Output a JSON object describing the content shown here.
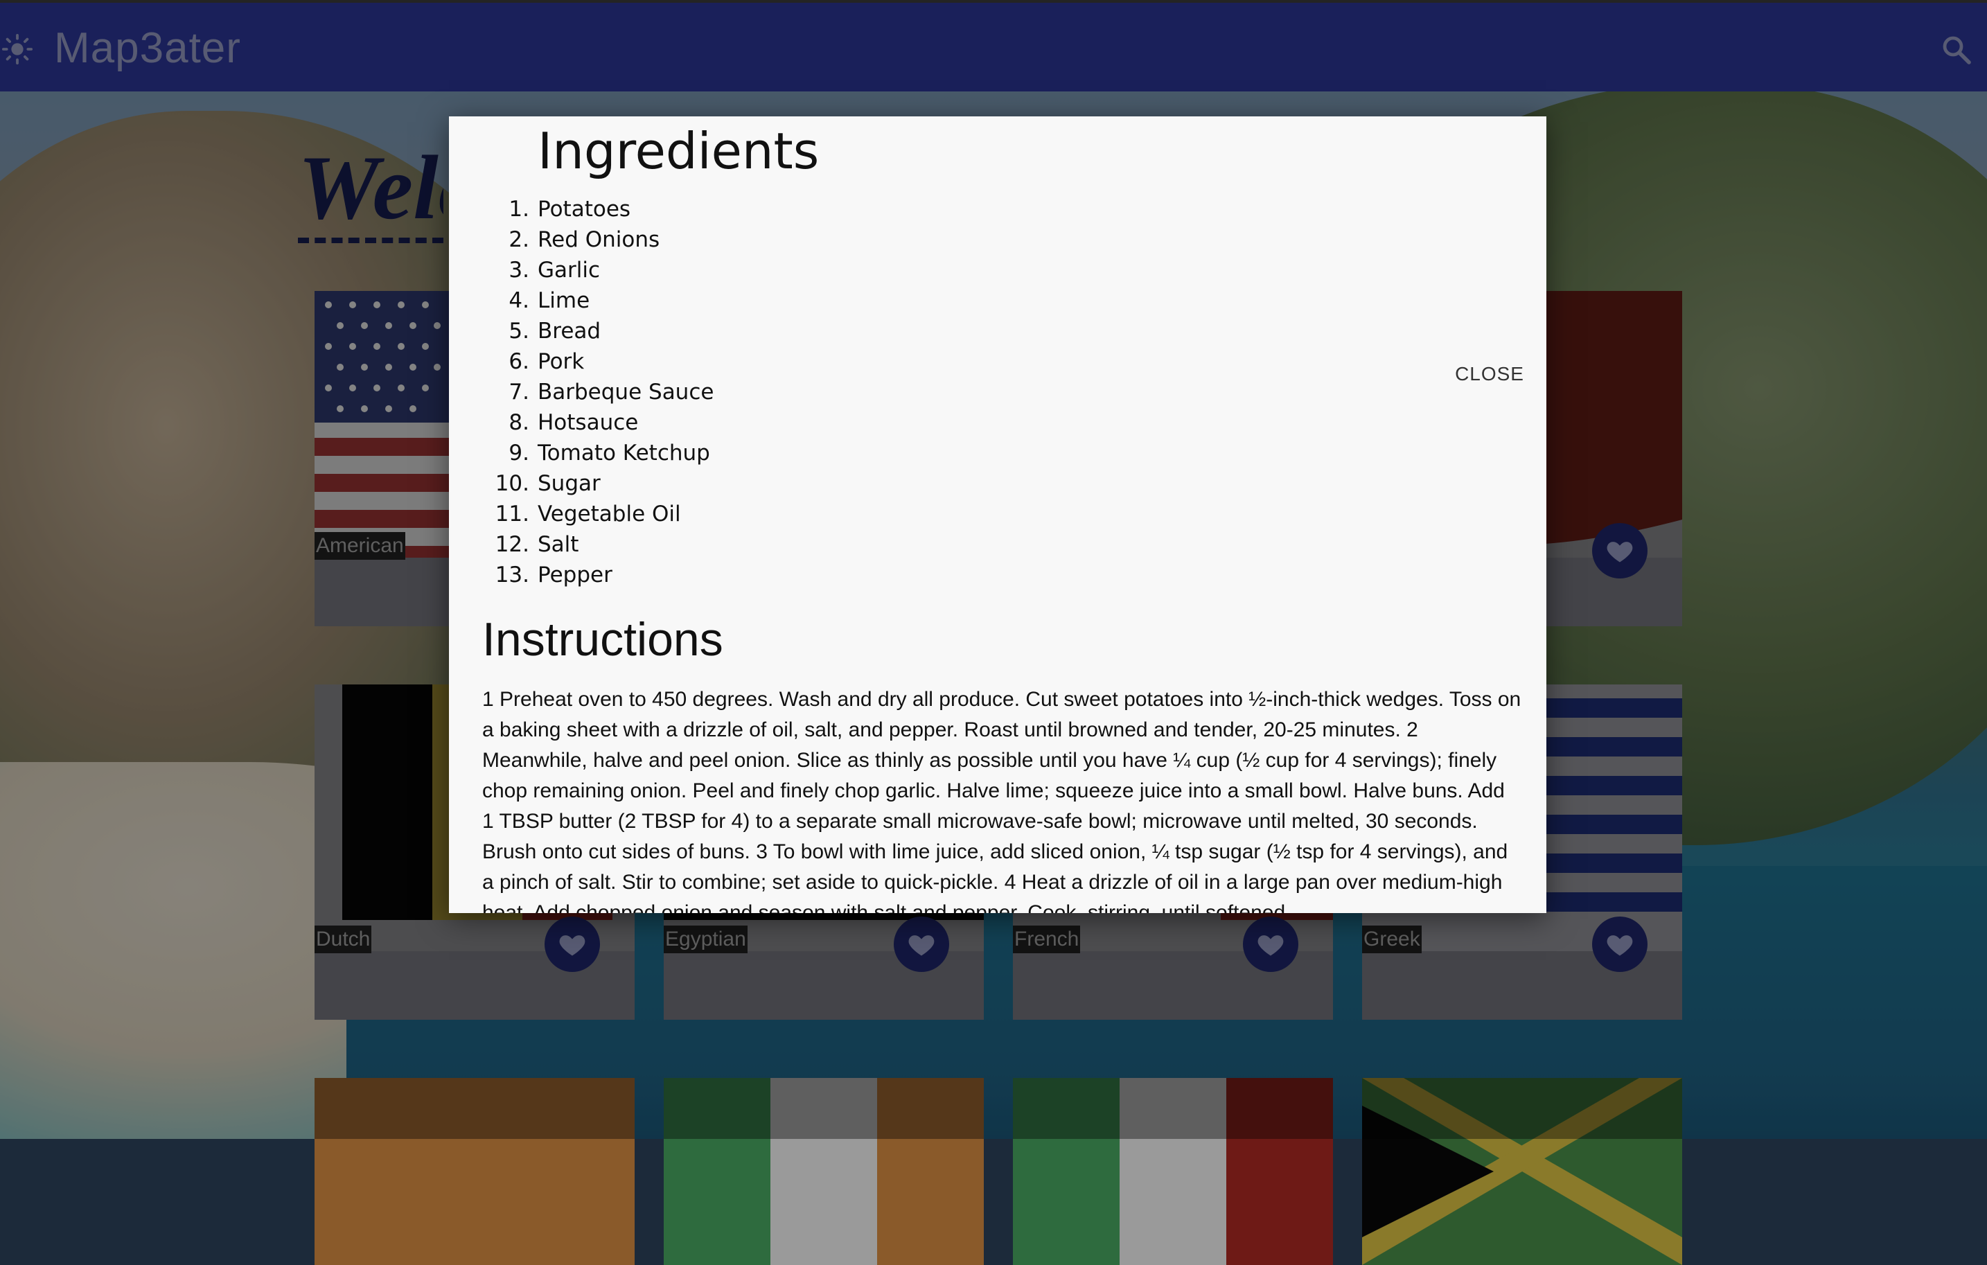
{
  "app": {
    "title": "Map3ater",
    "theme_icon": "sun-icon",
    "search_icon": "search-icon",
    "bar_color": "#2a3592"
  },
  "page": {
    "heading_fragment": "Welc"
  },
  "cards": [
    {
      "label": "American",
      "favorite_icon": "heart-icon"
    },
    {
      "label": "",
      "favorite_icon": "heart-icon"
    },
    {
      "label": "Dutch",
      "favorite_icon": "heart-icon"
    },
    {
      "label": "Egyptian",
      "favorite_icon": "heart-icon"
    },
    {
      "label": "French",
      "favorite_icon": "heart-icon"
    },
    {
      "label": "Greek",
      "favorite_icon": "heart-icon"
    }
  ],
  "modal": {
    "ingredients_title": "Ingredients",
    "close_label": "CLOSE",
    "ingredients": [
      "Potatoes",
      "Red Onions",
      "Garlic",
      "Lime",
      "Bread",
      "Pork",
      "Barbeque Sauce",
      "Hotsauce",
      "Tomato Ketchup",
      "Sugar",
      "Vegetable Oil",
      "Salt",
      "Pepper"
    ],
    "instructions_title": "Instructions",
    "instructions_text": "1 Preheat oven to 450 degrees. Wash and dry all produce. Cut sweet potatoes into ½-inch-thick wedges. Toss on a baking sheet with a drizzle of oil, salt, and pepper. Roast until browned and tender, 20-25 minutes. 2 Meanwhile, halve and peel onion. Slice as thinly as possible until you have ¼ cup (½ cup for 4 servings); finely chop remaining onion. Peel and finely chop garlic. Halve lime; squeeze juice into a small bowl. Halve buns. Add 1 TBSP butter (2 TBSP for 4) to a separate small microwave-safe bowl; microwave until melted, 30 seconds. Brush onto cut sides of buns. 3 To bowl with lime juice, add sliced onion, ¼ tsp sugar (½ tsp for 4 servings), and a pinch of salt. Stir to combine; set aside to quick-pickle. 4 Heat a drizzle of oil in a large pan over medium-high heat. Add chopped onion and season with salt and pepper. Cook, stirring, until softened"
  }
}
